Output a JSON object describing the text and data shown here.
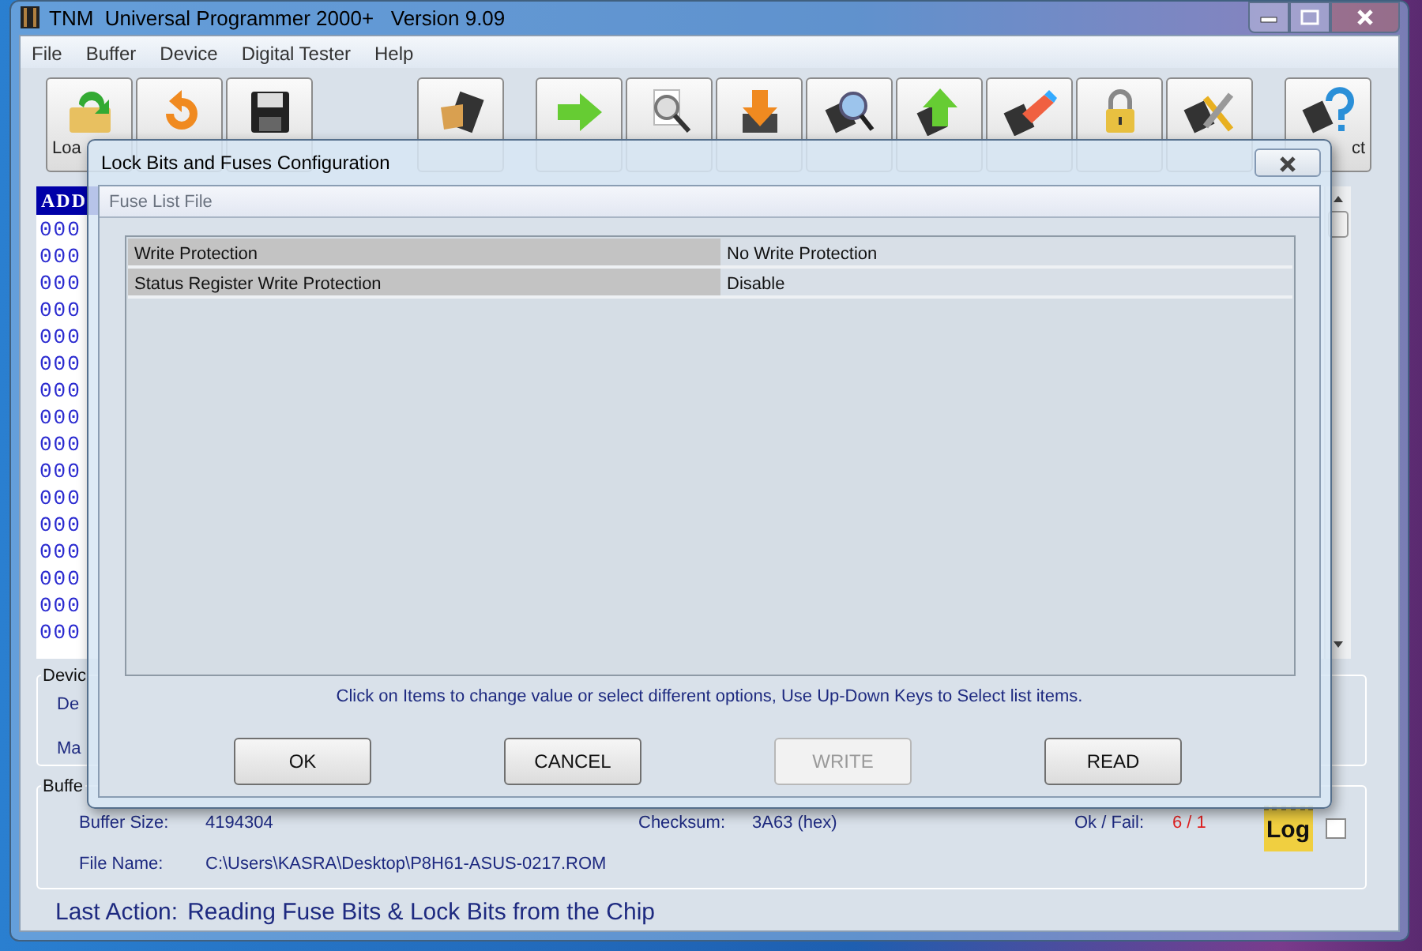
{
  "window": {
    "title": "TNM  Universal Programmer 2000+   Version 9.09"
  },
  "menu": [
    {
      "label": "File"
    },
    {
      "label": "Buffer"
    },
    {
      "label": "Device"
    },
    {
      "label": "Digital Tester"
    },
    {
      "label": "Help"
    }
  ],
  "toolbar": {
    "first_label": "Loa",
    "last_label": "ct"
  },
  "hex_view": {
    "header": "ADD",
    "rows": [
      "000",
      "000",
      "000",
      "000",
      "000",
      "000",
      "000",
      "000",
      "000",
      "000",
      "000",
      "000",
      "000",
      "000",
      "000",
      "000"
    ]
  },
  "device_group": {
    "legend": "Devic",
    "labels": [
      "De",
      "Ma"
    ]
  },
  "buffer_group": {
    "legend": "Buffe",
    "buffer_size_label": "Buffer Size:",
    "buffer_size": "4194304",
    "checksum_label": "Checksum:",
    "checksum": "3A63 (hex)",
    "ok_fail_label": "Ok / Fail:",
    "ok_fail": "6 / 1",
    "file_name_label": "File Name:",
    "file_name": "C:\\Users\\KASRA\\Desktop\\P8H61-ASUS-0217.ROM",
    "log_label": "Log",
    "log_checked": false
  },
  "last_action": {
    "label": "Last Action:",
    "value": "Reading Fuse Bits & Lock Bits from the Chip"
  },
  "dialog": {
    "title": "Lock Bits and Fuses Configuration",
    "group": "Fuse List File",
    "fuses": [
      {
        "name": "Write Protection",
        "value": "No Write Protection"
      },
      {
        "name": "Status Register Write Protection",
        "value": "Disable"
      }
    ],
    "hint": "Click on Items to change value or select different options, Use Up-Down Keys to Select list items.",
    "buttons": [
      {
        "label": "OK",
        "disabled": false
      },
      {
        "label": "CANCEL",
        "disabled": false
      },
      {
        "label": "WRITE",
        "disabled": true
      },
      {
        "label": "READ",
        "disabled": false
      }
    ]
  }
}
